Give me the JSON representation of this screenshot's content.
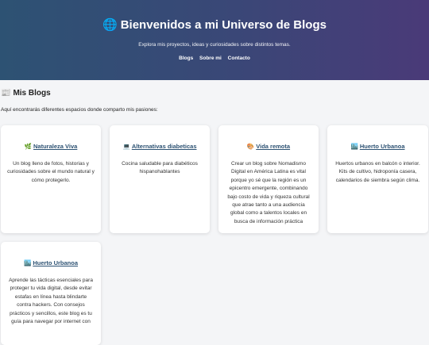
{
  "header": {
    "globe_icon": "🌐",
    "title": "Bienvenidos a mi Universo de Blogs",
    "subtitle": "Explora mis proyectos, ideas y curiosidades sobre distintos temas.",
    "nav": [
      "Blogs",
      "Sobre mi",
      "Contacto"
    ]
  },
  "section": {
    "icon": "📰",
    "title": "Mis Blogs",
    "description": "Aquí encontrarás diferentes espacios donde comparto mis pasiones:"
  },
  "cards": [
    {
      "icon": "🌿",
      "title": "Naturaleza Viva",
      "text": "Un blog lleno de fotos, historias y curiosidades sobre el mundo natural y cómo protegerlo."
    },
    {
      "icon": "💻",
      "title": "Alternativas diabeticas",
      "text": "Cocina saludable para diabéticos hispanohablantes"
    },
    {
      "icon": "🎨",
      "title": "Vida remota",
      "text": "Crear un blog sobre Nomadismo Digital en América Latina es vital porque yo sé que la región es un epicentro emergente, combinando bajo costo de vida y riqueza cultural que atrae tanto a una audiencia global como a talentos locales en busca de información práctica"
    },
    {
      "icon": "🏙️",
      "title": "Huerto Urbanoa",
      "text": "Huertos urbanos en balcón o interior. Kits de cultivo, hidroponía casera, calendarios de siembra según clima."
    },
    {
      "icon": "🏙️",
      "title": "Huerto Urbanoa",
      "text": "Aprende las tácticas esenciales para proteger tu vida digital, desde evitar estafas en línea hasta blindarte contra hackers. Con consejos prácticos y sencillos, este blog es tu guía para navegar por internet con"
    }
  ]
}
